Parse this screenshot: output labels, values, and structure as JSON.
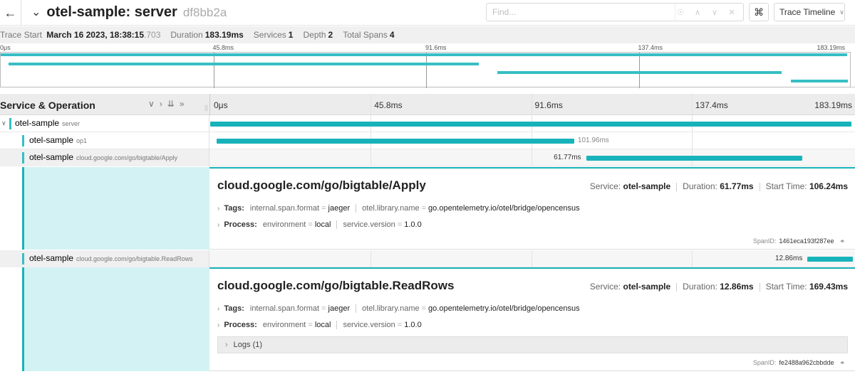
{
  "header": {
    "back_icon": "arrow-left-icon",
    "title": "otel-sample: server",
    "trace_id": "df8bb2a",
    "find_placeholder": "Find...",
    "view_select": "Trace Timeline"
  },
  "summary": {
    "trace_start_label": "Trace Start",
    "trace_start_date": "March 16 2023, 18:38:15",
    "trace_start_ms": ".703",
    "duration_label": "Duration",
    "duration": "183.19ms",
    "services_label": "Services",
    "services": "1",
    "depth_label": "Depth",
    "depth": "2",
    "total_spans_label": "Total Spans",
    "total_spans": "4"
  },
  "ticks": [
    "0μs",
    "45.8ms",
    "91.6ms",
    "137.4ms",
    "183.19ms"
  ],
  "columns": {
    "service_operation": "Service & Operation"
  },
  "spans": [
    {
      "service": "otel-sample",
      "operation": "server",
      "start_ms": 0,
      "duration_ms": 183.19,
      "duration_label": ""
    },
    {
      "service": "otel-sample",
      "operation": "op1",
      "start_ms": 0.9,
      "duration_ms": 101.96,
      "duration_label": "101.96ms"
    },
    {
      "service": "otel-sample",
      "operation": "cloud.google.com/go/bigtable/Apply",
      "start_ms": 106.24,
      "duration_ms": 61.77,
      "duration_label": "61.77ms"
    },
    {
      "service": "otel-sample",
      "operation": "cloud.google.com/go/bigtable.ReadRows",
      "start_ms": 169.43,
      "duration_ms": 12.86,
      "duration_label": "12.86ms"
    }
  ],
  "details": [
    {
      "title": "cloud.google.com/go/bigtable/Apply",
      "service_label": "Service:",
      "service": "otel-sample",
      "duration_label": "Duration:",
      "duration": "61.77ms",
      "start_label": "Start Time:",
      "start": "106.24ms",
      "tags_label": "Tags:",
      "tag1_key": "internal.span.format",
      "tag1_val": "jaeger",
      "tag2_key": "otel.library.name",
      "tag2_val": "go.opentelemetry.io/otel/bridge/opencensus",
      "process_label": "Process:",
      "proc1_key": "environment",
      "proc1_val": "local",
      "proc2_key": "service.version",
      "proc2_val": "1.0.0",
      "spanid_label": "SpanID:",
      "spanid": "1461eca193f287ee"
    },
    {
      "title": "cloud.google.com/go/bigtable.ReadRows",
      "service_label": "Service:",
      "service": "otel-sample",
      "duration_label": "Duration:",
      "duration": "12.86ms",
      "start_label": "Start Time:",
      "start": "169.43ms",
      "tags_label": "Tags:",
      "tag1_key": "internal.span.format",
      "tag1_val": "jaeger",
      "tag2_key": "otel.library.name",
      "tag2_val": "go.opentelemetry.io/otel/bridge/opencensus",
      "process_label": "Process:",
      "proc1_key": "environment",
      "proc1_val": "local",
      "proc2_key": "service.version",
      "proc2_val": "1.0.0",
      "logs_label": "Logs",
      "logs_count": "(1)",
      "spanid_label": "SpanID:",
      "spanid": "fe2488a962cbbdde"
    }
  ],
  "colors": {
    "accent": "#18b3ba",
    "detail_bg": "#d3f2f3"
  }
}
